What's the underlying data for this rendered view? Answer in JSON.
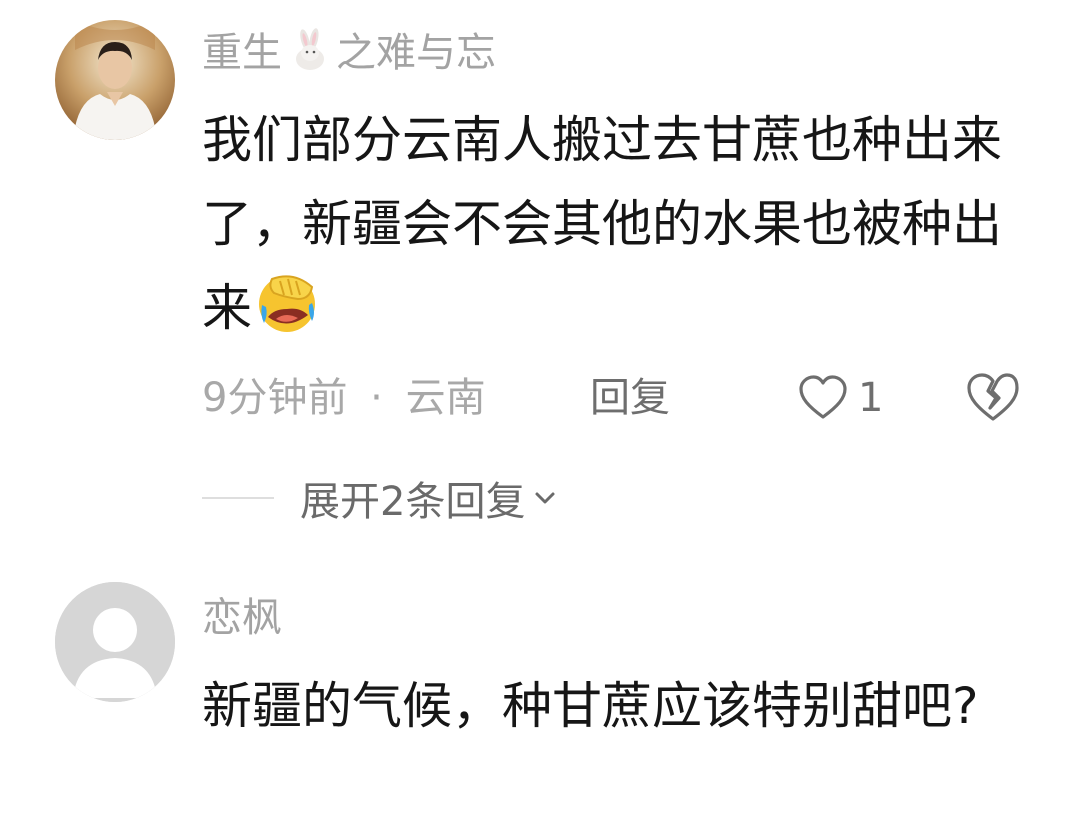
{
  "comments": [
    {
      "author": "重生",
      "author_suffix": "之难与忘",
      "author_emoji": "rabbit-emoji",
      "text": "我们部分云南人搬过去甘蔗也种出来了，新疆会不会其他的水果也被种出来",
      "text_emoji": "face-palm-laughing-emoji",
      "time": "9分钟前",
      "separator": "·",
      "location": "云南",
      "reply_label": "回复",
      "like_count": "1",
      "like_icon": "heart-outline-icon",
      "dislike_icon": "broken-heart-icon",
      "expand_label": "展开2条回复",
      "expand_icon": "chevron-down-icon"
    },
    {
      "author": "恋枫",
      "text": "新疆的气候，种甘蔗应该特别甜吧?",
      "avatar": "default-avatar"
    }
  ],
  "colors": {
    "background": "#ffffff",
    "author": "#a3a3a3",
    "body": "#161616",
    "meta": "#a8a8a8",
    "action": "#6e6e6e"
  }
}
